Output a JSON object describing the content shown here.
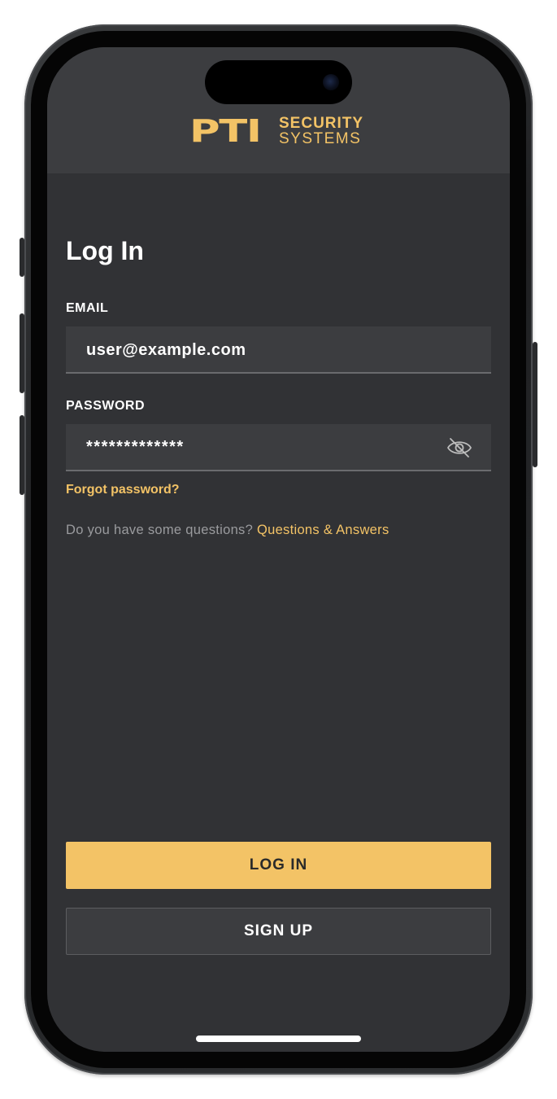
{
  "brand": {
    "logo_main": "PTI",
    "logo_line1": "SECURITY",
    "logo_line2": "SYSTEMS",
    "accent_color": "#f3c366"
  },
  "page": {
    "title": "Log In"
  },
  "email": {
    "label": "EMAIL",
    "value": "user@example.com"
  },
  "password": {
    "label": "PASSWORD",
    "value": "*************",
    "toggle_icon": "eye-slash-icon"
  },
  "links": {
    "forgot_password": "Forgot password?",
    "questions_prompt": "Do you have some questions?",
    "questions_link": "Questions & Answers"
  },
  "buttons": {
    "login": "LOG IN",
    "signup": "SIGN UP"
  }
}
